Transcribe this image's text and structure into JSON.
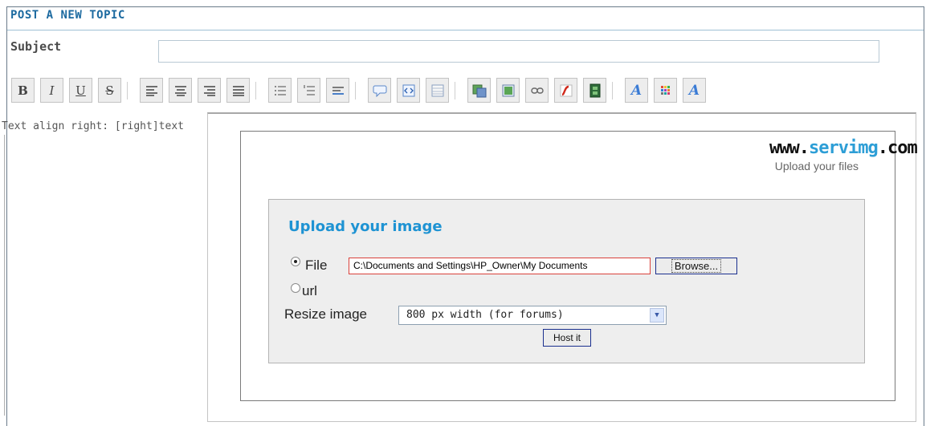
{
  "form": {
    "title": "POST A NEW TOPIC",
    "subject_label": "Subject",
    "subject_value": "",
    "hint": "Text align right: [right]text"
  },
  "toolbar": {
    "buttons": [
      {
        "name": "bold",
        "glyph": "B"
      },
      {
        "name": "italic",
        "glyph": "I"
      },
      {
        "name": "underline",
        "glyph": "U"
      },
      {
        "name": "strikethrough",
        "glyph": "S"
      },
      {
        "name": "align-left",
        "glyph": ""
      },
      {
        "name": "align-center",
        "glyph": ""
      },
      {
        "name": "align-right",
        "glyph": ""
      },
      {
        "name": "justify",
        "glyph": ""
      },
      {
        "name": "bullet-list",
        "glyph": ""
      },
      {
        "name": "numbered-list",
        "glyph": ""
      },
      {
        "name": "horizontal-rule",
        "glyph": ""
      },
      {
        "name": "quote",
        "glyph": ""
      },
      {
        "name": "code",
        "glyph": ""
      },
      {
        "name": "table",
        "glyph": ""
      },
      {
        "name": "host-image",
        "glyph": ""
      },
      {
        "name": "image",
        "glyph": ""
      },
      {
        "name": "link",
        "glyph": ""
      },
      {
        "name": "flash",
        "glyph": ""
      },
      {
        "name": "video",
        "glyph": ""
      },
      {
        "name": "font-size",
        "glyph": ""
      },
      {
        "name": "font-color",
        "glyph": ""
      },
      {
        "name": "font-face",
        "glyph": "A"
      }
    ]
  },
  "popup": {
    "logo_prefix": "www.",
    "logo_name": "servimg",
    "logo_suffix": ".com",
    "tagline": "Upload your files",
    "upload_title": "Upload your image",
    "file_label": "File",
    "file_value": "C:\\Documents and Settings\\HP_Owner\\My Documents",
    "browse_label": "Browse...",
    "url_label": "url",
    "resize_label": "Resize image",
    "resize_selected": "800 px width (for forums)",
    "host_label": "Host it"
  },
  "colors": {
    "title_blue": "#1c6aa0",
    "upload_title_blue": "#1e93d3",
    "logo_accent": "#2d9ed6",
    "file_field_border": "#d9413b"
  }
}
